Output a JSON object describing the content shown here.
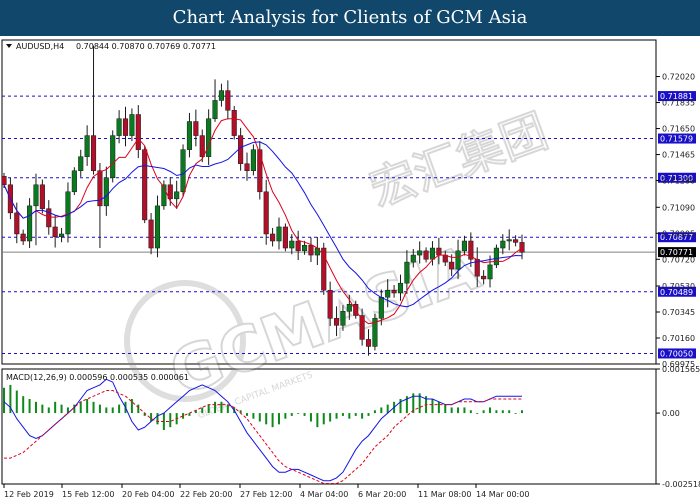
{
  "header": {
    "title": "Chart Analysis for Clients of GCM Asia"
  },
  "watermark": {
    "text": "GCMASIA",
    "chinese": "宏汇集团",
    "sub": "GLOBAL CAPITAL MARKETS"
  },
  "chart_data": [
    {
      "type": "candlestick",
      "title": "AUDUSD,H4",
      "ohlc_label": "0.70844 0.70870 0.70769 0.70771",
      "symbol": "AUDUSD",
      "timeframe": "H4",
      "ylim": [
        0.69975,
        0.7228
      ],
      "y_ticks": [
        "0.72020",
        "0.71835",
        "0.71650",
        "0.71465",
        "0.71280",
        "0.71090",
        "0.70905",
        "0.70720",
        "0.70530",
        "0.70345",
        "0.70160",
        "0.69975"
      ],
      "x_ticks": [
        "12 Feb 2019",
        "15 Feb 12:00",
        "20 Feb 04:00",
        "22 Feb 20:00",
        "27 Feb 12:00",
        "4 Mar 04:00",
        "6 Mar 20:00",
        "11 Mar 08:00",
        "14 Mar 00:00"
      ],
      "horizontal_levels": [
        "0.71881",
        "0.71579",
        "0.71300",
        "0.70877",
        "0.70489",
        "0.70050"
      ],
      "current_price": "0.70771",
      "level_color": "#1a0fc8",
      "price_line_color": "#808080",
      "close_path": [
        0.7125,
        0.7105,
        0.709,
        0.7085,
        0.711,
        0.7125,
        0.7108,
        0.7095,
        0.7088,
        0.709,
        0.712,
        0.7135,
        0.7145,
        0.716,
        0.7135,
        0.711,
        0.713,
        0.716,
        0.7172,
        0.716,
        0.7175,
        0.715,
        0.71,
        0.708,
        0.711,
        0.7125,
        0.7115,
        0.712,
        0.715,
        0.717,
        0.716,
        0.7145,
        0.7172,
        0.7185,
        0.7192,
        0.7178,
        0.716,
        0.714,
        0.7135,
        0.715,
        0.712,
        0.709,
        0.7085,
        0.7095,
        0.708,
        0.7085,
        0.7078,
        0.7082,
        0.7075,
        0.708,
        0.705,
        0.703,
        0.7025,
        0.7035,
        0.704,
        0.7032,
        0.7015,
        0.701,
        0.703,
        0.7045,
        0.705,
        0.7048,
        0.7055,
        0.707,
        0.7075,
        0.7078,
        0.7072,
        0.708,
        0.7075,
        0.707,
        0.7065,
        0.7078,
        0.7085,
        0.7072,
        0.706,
        0.7058,
        0.7068,
        0.708,
        0.7085,
        0.7086,
        0.7084,
        0.7077
      ],
      "series": [
        {
          "name": "",
          "color": "#e0001a"
        },
        {
          "name": "",
          "color": "#1414e6"
        }
      ],
      "colors": {
        "bull": "#0a7a1e",
        "bear": "#b0102a"
      }
    },
    {
      "type": "macd",
      "title": "MACD(12,26,9) 0.000596 0.000535 0.000061",
      "ylim": [
        -0.002518,
        0.001565
      ],
      "y_ticks": [
        "0.001565",
        "0.00",
        "-0.002518"
      ],
      "histogram": [
        0.0009,
        0.001,
        0.0008,
        0.0006,
        0.0005,
        0.0004,
        0.0003,
        0.0002,
        0.0004,
        0.0003,
        0.0002,
        0.0003,
        0.0004,
        0.0005,
        0.0004,
        0.0003,
        0.0002,
        0.0002,
        0.0003,
        0.0004,
        0.0005,
        0.0003,
        -0.0001,
        -0.0003,
        -0.0004,
        -0.0006,
        -0.0005,
        -0.0004,
        -0.0002,
        -0.0001,
        0.0001,
        0.0002,
        0.0003,
        0.0004,
        0.0004,
        0.0003,
        0.0002,
        0.0001,
        -0.0001,
        -0.0002,
        -0.0003,
        -0.0004,
        -0.0005,
        -0.0004,
        -0.0002,
        -0.0001,
        0.0,
        -0.0001,
        -0.0003,
        -0.0005,
        -0.0004,
        -0.0003,
        -0.0002,
        -0.0001,
        -0.0002,
        -0.0001,
        -0.0002,
        -0.0001,
        0.0001,
        0.0002,
        0.0003,
        0.0004,
        0.0005,
        0.0006,
        0.0007,
        0.0007,
        0.0006,
        0.0005,
        0.0004,
        0.0003,
        0.0002,
        0.0002,
        0.0002,
        0.0001,
        0.0,
        0.0001,
        0.0002,
        0.0001,
        0.0001,
        0.0001,
        0.0,
        0.0001
      ],
      "macd": [
        0.0004,
        0.0002,
        -0.0002,
        -0.0005,
        -0.0008,
        -0.0009,
        -0.0008,
        -0.0006,
        -0.0004,
        -0.0002,
        0.0,
        0.0002,
        0.0005,
        0.0008,
        0.0009,
        0.001,
        0.0012,
        0.0011,
        0.0006,
        0.0002,
        -0.0003,
        -0.0006,
        -0.0005,
        -0.0003,
        -0.0001,
        0.0,
        0.0002,
        0.0004,
        0.0006,
        0.0008,
        0.0009,
        0.001,
        0.0009,
        0.0008,
        0.0006,
        0.0004,
        0.0001,
        -0.0003,
        -0.0007,
        -0.001,
        -0.0013,
        -0.0016,
        -0.0019,
        -0.0021,
        -0.0021,
        -0.002,
        -0.002,
        -0.0021,
        -0.0022,
        -0.0023,
        -0.0024,
        -0.0024,
        -0.0023,
        -0.0021,
        -0.0017,
        -0.0013,
        -0.001,
        -0.0008,
        -0.0005,
        -0.0002,
        0.0,
        0.0002,
        0.0004,
        0.0005,
        0.0006,
        0.0006,
        0.0005,
        0.0005,
        0.0004,
        0.0003,
        0.0003,
        0.0004,
        0.0005,
        0.0005,
        0.0004,
        0.0004,
        0.0005,
        0.0006,
        0.0006,
        0.0006,
        0.0006,
        0.0006
      ],
      "signal": [
        -0.0016,
        -0.0016,
        -0.0015,
        -0.0014,
        -0.0012,
        -0.001,
        -0.0008,
        -0.0006,
        -0.0004,
        -0.0002,
        0.0,
        0.0002,
        0.0004,
        0.0005,
        0.0006,
        0.0007,
        0.0008,
        0.0008,
        0.0007,
        0.0006,
        0.0004,
        0.0002,
        0.0,
        -0.0002,
        -0.0003,
        -0.0003,
        -0.0003,
        -0.0002,
        -0.0001,
        0.0,
        0.0001,
        0.0002,
        0.0003,
        0.0003,
        0.0003,
        0.0003,
        0.0002,
        0.0,
        -0.0002,
        -0.0005,
        -0.0008,
        -0.0011,
        -0.0014,
        -0.0017,
        -0.0019,
        -0.002,
        -0.0021,
        -0.0022,
        -0.0023,
        -0.0024,
        -0.0025,
        -0.0025,
        -0.0025,
        -0.0024,
        -0.0022,
        -0.002,
        -0.0018,
        -0.0015,
        -0.0012,
        -0.001,
        -0.0008,
        -0.0005,
        -0.0003,
        -0.0001,
        0.0001,
        0.0002,
        0.0003,
        0.0003,
        0.0003,
        0.0003,
        0.0003,
        0.0004,
        0.0004,
        0.0004,
        0.0004,
        0.0004,
        0.0005,
        0.0005,
        0.0005,
        0.0005,
        0.0005,
        0.0005
      ],
      "colors": {
        "histogram": "#0e8a1a",
        "macd": "#1414e6",
        "signal": "#e0001a"
      }
    }
  ]
}
